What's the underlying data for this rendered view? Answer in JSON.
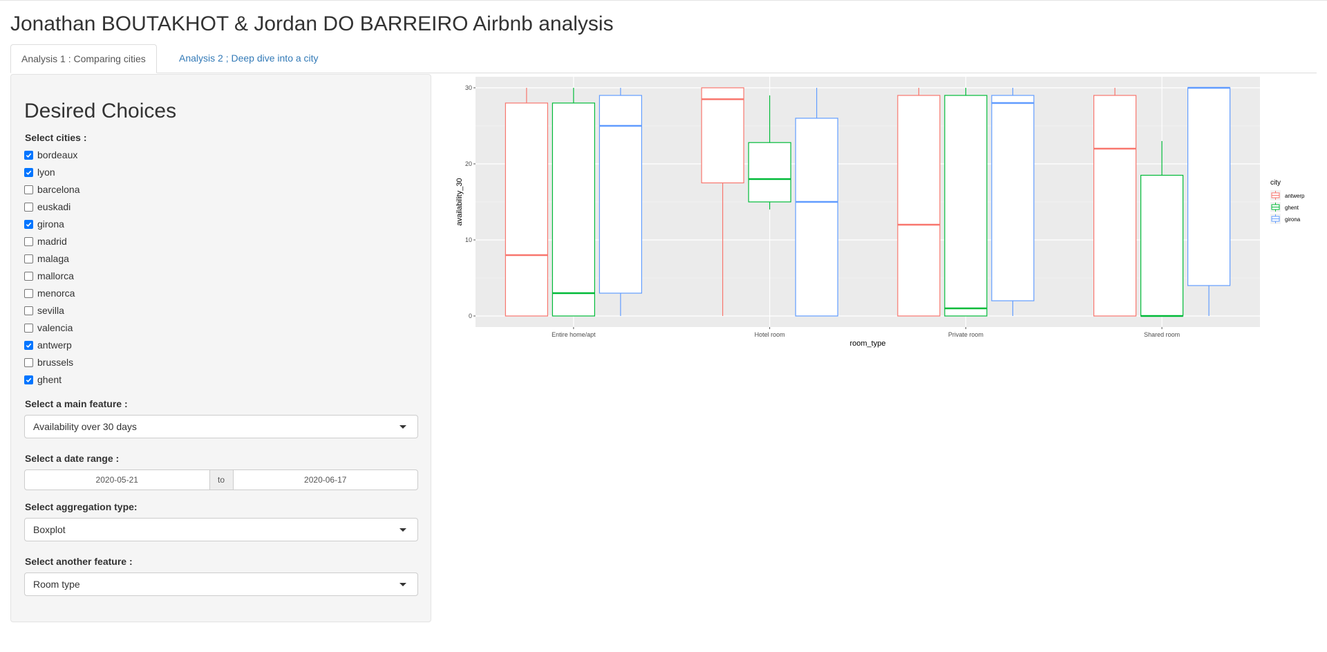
{
  "app": {
    "title": "Jonathan BOUTAKHOT & Jordan DO BARREIRO Airbnb analysis"
  },
  "tabs": [
    {
      "label": "Analysis 1 : Comparing cities",
      "active": true
    },
    {
      "label": "Analysis 2 ; Deep dive into a city",
      "active": false
    }
  ],
  "sidebar": {
    "heading": "Desired Choices",
    "cities_label": "Select cities :",
    "cities": [
      {
        "label": "bordeaux",
        "checked": true
      },
      {
        "label": "lyon",
        "checked": true
      },
      {
        "label": "barcelona",
        "checked": false
      },
      {
        "label": "euskadi",
        "checked": false
      },
      {
        "label": "girona",
        "checked": true
      },
      {
        "label": "madrid",
        "checked": false
      },
      {
        "label": "malaga",
        "checked": false
      },
      {
        "label": "mallorca",
        "checked": false
      },
      {
        "label": "menorca",
        "checked": false
      },
      {
        "label": "sevilla",
        "checked": false
      },
      {
        "label": "valencia",
        "checked": false
      },
      {
        "label": "antwerp",
        "checked": true
      },
      {
        "label": "brussels",
        "checked": false
      },
      {
        "label": "ghent",
        "checked": true
      }
    ],
    "main_feature_label": "Select a main feature :",
    "main_feature_value": "Availability over 30 days",
    "date_range_label": "Select a date range :",
    "date_start": "2020-05-21",
    "date_sep": "to",
    "date_end": "2020-06-17",
    "aggregation_label": "Select aggregation type:",
    "aggregation_value": "Boxplot",
    "another_feature_label": "Select another feature :",
    "another_feature_value": "Room type"
  },
  "colors": {
    "checkbox_accent": "#0075ff",
    "tab_link": "#337ab7",
    "panel_bg": "#f5f5f5",
    "plot_bg": "#ebebeb"
  },
  "chart_data": {
    "type": "boxplot",
    "xlabel": "room_type",
    "ylabel": "availability_30",
    "ylim": [
      0,
      30
    ],
    "yticks": [
      0,
      10,
      20,
      30
    ],
    "categories": [
      "Entire home/apt",
      "Hotel room",
      "Private room",
      "Shared room"
    ],
    "legend": {
      "title": "city",
      "position": "right"
    },
    "grid": true,
    "series": [
      {
        "name": "antwerp",
        "color": "#F8766D",
        "boxes": [
          {
            "min": 0,
            "q1": 0,
            "median": 8,
            "q3": 28,
            "max": 30
          },
          {
            "min": 0,
            "q1": 17.5,
            "median": 28.5,
            "q3": 30,
            "max": 30
          },
          {
            "min": 0,
            "q1": 0,
            "median": 12,
            "q3": 29,
            "max": 30
          },
          {
            "min": 0,
            "q1": 0,
            "median": 22,
            "q3": 29,
            "max": 30
          }
        ]
      },
      {
        "name": "ghent",
        "color": "#00BA38",
        "boxes": [
          {
            "min": 0,
            "q1": 0,
            "median": 3,
            "q3": 28,
            "max": 30
          },
          {
            "min": 14,
            "q1": 15,
            "median": 18,
            "q3": 22.8,
            "max": 29
          },
          {
            "min": 0,
            "q1": 0,
            "median": 1,
            "q3": 29,
            "max": 30
          },
          {
            "min": 0,
            "q1": 0,
            "median": 0,
            "q3": 18.5,
            "max": 23
          }
        ]
      },
      {
        "name": "girona",
        "color": "#619CFF",
        "boxes": [
          {
            "min": 0,
            "q1": 3,
            "median": 25,
            "q3": 29,
            "max": 30
          },
          {
            "min": 0,
            "q1": 0,
            "median": 15,
            "q3": 26,
            "max": 30
          },
          {
            "min": 0,
            "q1": 2,
            "median": 28,
            "q3": 29,
            "max": 30
          },
          {
            "min": 0,
            "q1": 4,
            "median": 30,
            "q3": 30,
            "max": 30
          }
        ]
      }
    ]
  }
}
